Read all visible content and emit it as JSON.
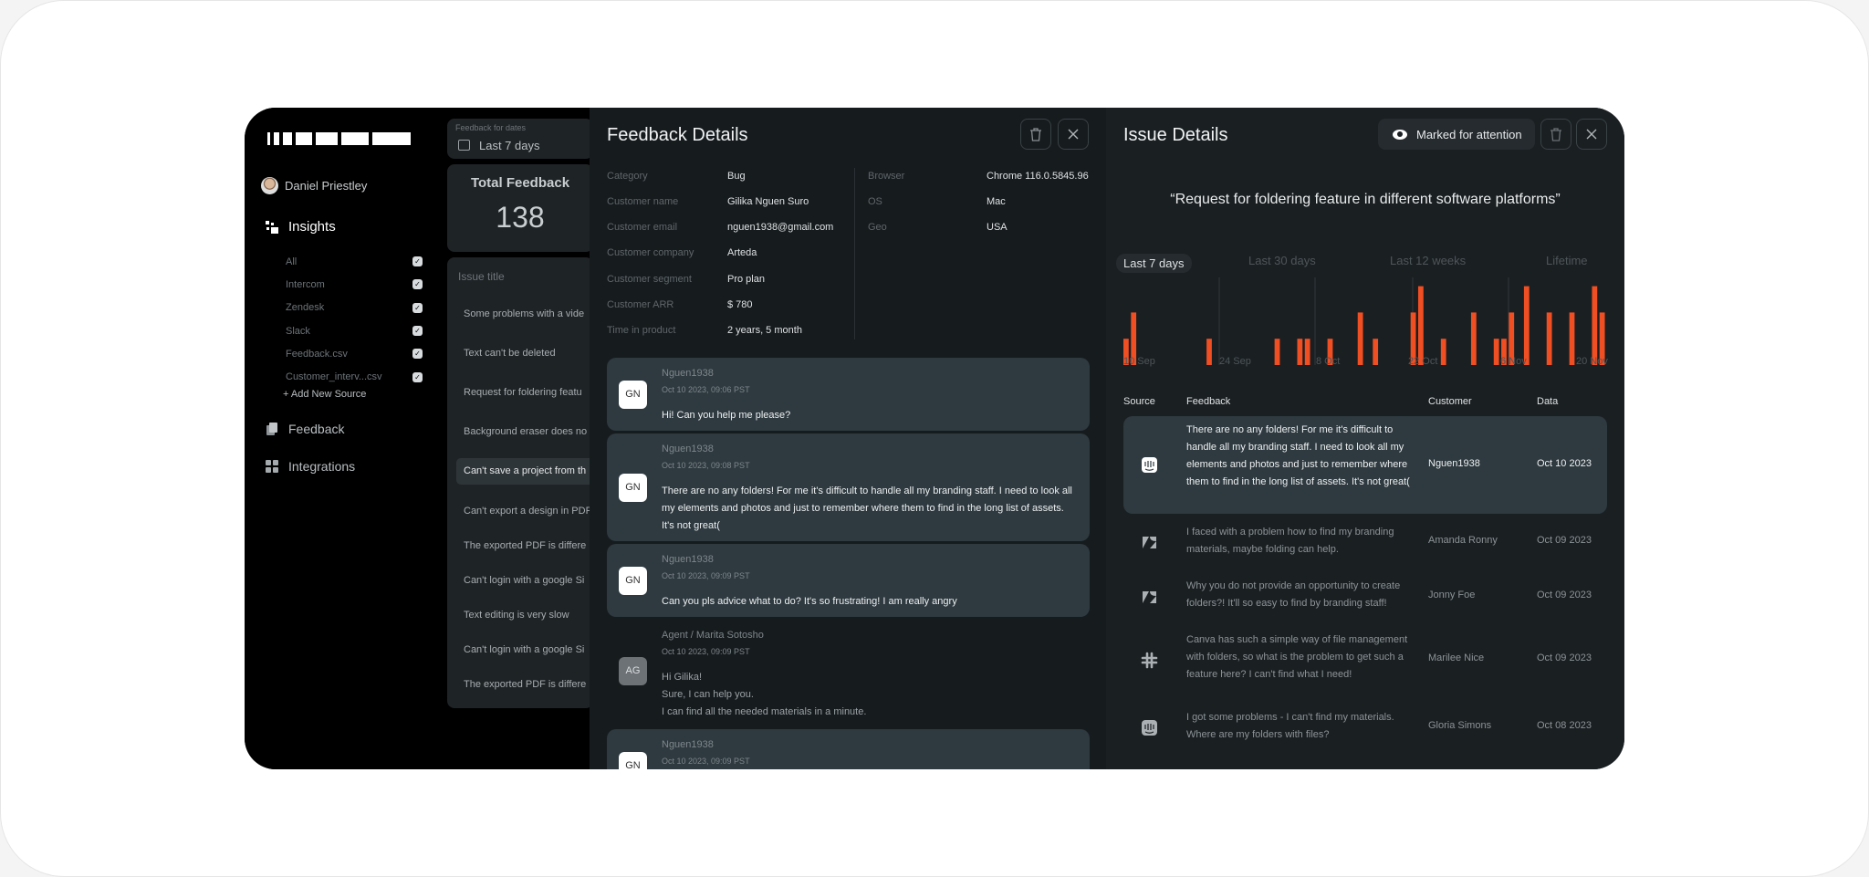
{
  "sidebar": {
    "user_name": "Daniel Priestley",
    "insights_label": "Insights",
    "sources": [
      {
        "label": "All",
        "checked": true
      },
      {
        "label": "Intercom",
        "checked": true
      },
      {
        "label": "Zendesk",
        "checked": true
      },
      {
        "label": "Slack",
        "checked": true
      },
      {
        "label": "Feedback.csv",
        "checked": true
      },
      {
        "label": "Customer_interv...csv",
        "checked": true
      }
    ],
    "add_source_label": "+ Add New Source",
    "feedback_label": "Feedback",
    "integrations_label": "Integrations"
  },
  "list": {
    "date_label": "Feedback for dates",
    "date_value": "Last 7 days",
    "total_title": "Total Feedback",
    "total_value": "138",
    "issues_header": "Issue title",
    "issues": [
      "Some problems with a vide",
      "Text can't be deleted",
      "Request for foldering featu",
      "Background eraser does no",
      "Can't save a project from th",
      "Can't export a design in PDF",
      "The exported PDF is differe",
      "Can't login with a google Si",
      "Text editing is very slow",
      "Can't login with a google Si",
      "The exported PDF is differe"
    ],
    "selected_index": 4
  },
  "feedback_details": {
    "title": "Feedback Details",
    "fields_left": [
      {
        "label": "Category",
        "value": "Bug"
      },
      {
        "label": "Customer name",
        "value": "Gilika Nguen Suro"
      },
      {
        "label": "Customer email",
        "value": "nguen1938@gmail.com"
      },
      {
        "label": "Customer company",
        "value": "Arteda"
      },
      {
        "label": "Customer segment",
        "value": "Pro plan"
      },
      {
        "label": "Customer ARR",
        "value": "$ 780"
      },
      {
        "label": "Time in product",
        "value": "2 years, 5 month"
      }
    ],
    "fields_right": [
      {
        "label": "Browser",
        "value": "Chrome 116.0.5845.96"
      },
      {
        "label": "OS",
        "value": "Mac"
      },
      {
        "label": "Geo",
        "value": "USA"
      }
    ],
    "messages": [
      {
        "initials": "GN",
        "name": "Nguen1938",
        "time": "Oct 10 2023, 09:06 PST",
        "lines": [
          "Hi! Can you help me please?"
        ],
        "agent": false
      },
      {
        "initials": "GN",
        "name": "Nguen1938",
        "time": "Oct 10 2023, 09:08 PST",
        "lines": [
          "There are no any folders! For me it's difficult to handle all my branding staff. I need to look all my elements and photos and just to remember where them to find in the long list of assets. It's not great("
        ],
        "agent": false
      },
      {
        "initials": "GN",
        "name": "Nguen1938",
        "time": "Oct 10 2023, 09:09 PST",
        "lines": [
          "Can you pls advice what to do? It's so frustrating! I am really angry"
        ],
        "agent": false
      },
      {
        "initials": "AG",
        "name": "Agent / Marita Sotosho",
        "time": "Oct 10 2023, 09:09 PST",
        "lines": [
          "Hi Gilika!",
          "Sure, I can help you.",
          "I can find all the needed materials in a minute."
        ],
        "agent": true
      },
      {
        "initials": "GN",
        "name": "Nguen1938",
        "time": "Oct 10 2023, 09:09 PST",
        "lines": [
          ""
        ],
        "agent": false
      }
    ]
  },
  "issue_details": {
    "title": "Issue Details",
    "marked_label": "Marked for attention",
    "quote": "“Request for foldering feature in different software platforms”",
    "periods": [
      "Last 7 days",
      "Last 30 days",
      "Last 12 weeks",
      "Lifetime"
    ],
    "active_period": 0,
    "table_headers": {
      "source": "Source",
      "feedback": "Feedback",
      "customer": "Customer",
      "date": "Data"
    },
    "rows": [
      {
        "source": "intercom-icon",
        "text": "There are no any folders! For me it's difficult to handle all my branding staff. I need to look all my elements and photos and just to remember where them to find in the long list of assets. It's not great(",
        "customer": "Nguen1938",
        "date": "Oct 10 2023",
        "selected": true
      },
      {
        "source": "zendesk-icon",
        "text": "I faced with a problem how to find my branding materials, maybe folding can help.",
        "customer": "Amanda Ronny",
        "date": "Oct 09 2023",
        "selected": false
      },
      {
        "source": "zendesk-icon",
        "text": "Why you do not provide an opportunity to create folders?! It'll so easy to find by branding staff!",
        "customer": "Jonny Foe",
        "date": "Oct 09 2023",
        "selected": false
      },
      {
        "source": "slack-icon",
        "text": "Canva has such a simple way of file management with folders, so what is the problem to get such a feature here? I can't find what I need!",
        "customer": "Marilee Nice",
        "date": "Oct 09 2023",
        "selected": false
      },
      {
        "source": "intercom-icon",
        "text": "I got some problems - I can't find my materials. Where are my folders with files?",
        "customer": "Gloria Simons",
        "date": "Oct 08 2023",
        "selected": false
      }
    ]
  },
  "chart_data": {
    "type": "bar",
    "x_labels": [
      "10 Sep",
      "24 Sep",
      "8 Oct",
      "22 Oct",
      "6 Nov",
      "20 Nov"
    ],
    "values": [
      1.2,
      2.4,
      0,
      0,
      0,
      0,
      0,
      0,
      0,
      0,
      0,
      1.2,
      0,
      0,
      0,
      0,
      0,
      0,
      0,
      0,
      1.2,
      0,
      0,
      1.2,
      1.2,
      0,
      0,
      1.2,
      0,
      0,
      0,
      2.4,
      0,
      1.2,
      0,
      0,
      0,
      0,
      2.4,
      3.6,
      0,
      0,
      1.2,
      0,
      0,
      0,
      2.4,
      0,
      0,
      1.2,
      1.2,
      2.4,
      0,
      3.6,
      0,
      0,
      2.4,
      0,
      0,
      2.4,
      0,
      0,
      3.6,
      2.4
    ],
    "color": "#f04e23"
  }
}
